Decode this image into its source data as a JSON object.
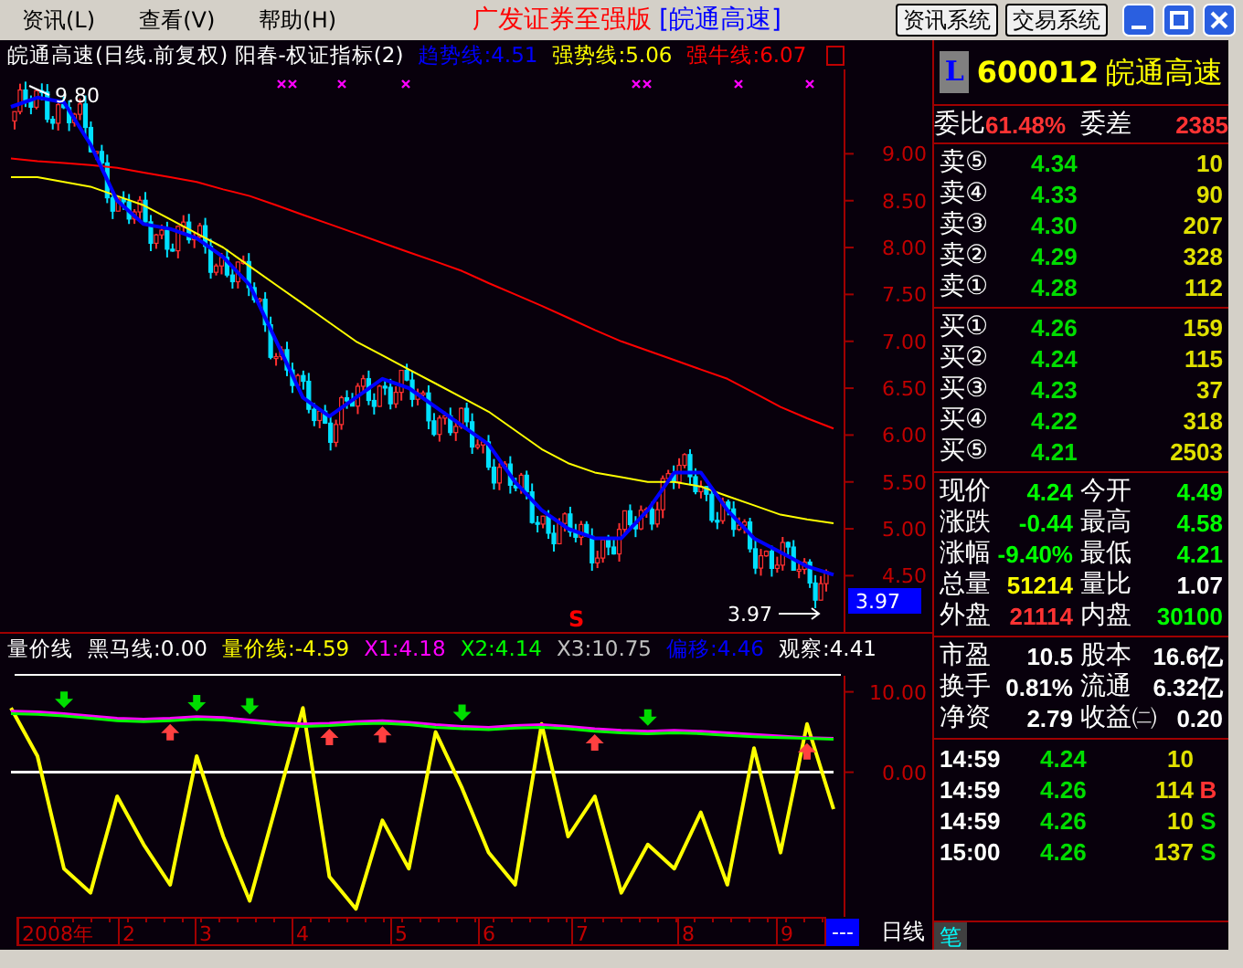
{
  "menu": [
    {
      "label": "资讯(L)"
    },
    {
      "label": "查看(V)"
    },
    {
      "label": "帮助(H)"
    }
  ],
  "title": {
    "app": "广发证券至强版",
    "stock": "[皖通高速]"
  },
  "system_buttons": [
    "资讯系统",
    "交易系统"
  ],
  "chart": {
    "title": "皖通高速(日线.前复权) 阳春-权证指标(2)",
    "lines": [
      {
        "label": "趋势线:4.51",
        "color": "#0000ff"
      },
      {
        "label": "强势线:5.06",
        "color": "#ffff00"
      },
      {
        "label": "强牛线:6.07",
        "color": "#ff0000"
      }
    ],
    "high_label": "9.80",
    "low_label": "3.97",
    "last_price": "3.97",
    "signal": "S",
    "chart_data": {
      "type": "line",
      "ylim": [
        3.9,
        9.9
      ],
      "yticks": [
        {
          "value": 9,
          "label": "9.00"
        },
        {
          "value": 8.5,
          "label": "8.50"
        },
        {
          "value": 8,
          "label": "8.00"
        },
        {
          "value": 7.5,
          "label": "7.50"
        },
        {
          "value": 7,
          "label": "7.00"
        },
        {
          "value": 6.5,
          "label": "6.50"
        },
        {
          "value": 6,
          "label": "6.00"
        },
        {
          "value": 5.5,
          "label": "5.50"
        },
        {
          "value": 5,
          "label": "5.00"
        },
        {
          "value": 4.5,
          "label": "4.50"
        }
      ],
      "series": [
        {
          "color": "#0000ff",
          "values": [
            9.5,
            9.6,
            9.55,
            9.1,
            8.5,
            8.25,
            8.2,
            8.1,
            7.9,
            7.6,
            7.0,
            6.4,
            6.2,
            6.4,
            6.6,
            6.5,
            6.3,
            6.1,
            5.9,
            5.5,
            5.2,
            5.0,
            4.9,
            4.9,
            5.2,
            5.6,
            5.6,
            5.2,
            4.9,
            4.75,
            4.6,
            4.51
          ]
        },
        {
          "color": "#ffff00",
          "values": [
            8.75,
            8.75,
            8.7,
            8.65,
            8.55,
            8.45,
            8.3,
            8.15,
            8.0,
            7.8,
            7.6,
            7.4,
            7.2,
            7.0,
            6.85,
            6.7,
            6.55,
            6.4,
            6.25,
            6.05,
            5.85,
            5.7,
            5.6,
            5.55,
            5.5,
            5.5,
            5.45,
            5.35,
            5.25,
            5.15,
            5.1,
            5.06
          ]
        },
        {
          "color": "#ff0000",
          "values": [
            8.95,
            8.92,
            8.9,
            8.88,
            8.85,
            8.8,
            8.75,
            8.7,
            8.62,
            8.55,
            8.45,
            8.35,
            8.25,
            8.15,
            8.05,
            7.95,
            7.85,
            7.75,
            7.62,
            7.5,
            7.38,
            7.25,
            7.12,
            7.0,
            6.9,
            6.8,
            6.7,
            6.6,
            6.45,
            6.3,
            6.18,
            6.07
          ]
        }
      ]
    }
  },
  "indicator": {
    "name": "量价线",
    "values": [
      {
        "label": "黑马线:0.00",
        "color": "#ffffff"
      },
      {
        "label": "量价线:-4.59",
        "color": "#ffff00"
      },
      {
        "label": "X1:4.18",
        "color": "#ff00ff"
      },
      {
        "label": "X2:4.14",
        "color": "#00ff00"
      },
      {
        "label": "X3:10.75",
        "color": "#c0c0c0"
      },
      {
        "label": "偏移:4.46",
        "color": "#0000ff"
      },
      {
        "label": "观察:4.41",
        "color": "#ffffff"
      }
    ],
    "chart_data": {
      "type": "line",
      "ylim": [
        -18,
        12
      ],
      "yticks": [
        {
          "value": 10,
          "label": "10.00"
        },
        {
          "value": 0,
          "label": "0.00"
        }
      ],
      "series": [
        {
          "color": "#ffffff",
          "values": [
            0,
            0,
            0,
            0,
            0,
            0,
            0,
            0,
            0,
            0,
            0,
            0,
            0,
            0,
            0,
            0,
            0,
            0,
            0,
            0,
            0,
            0,
            0,
            0,
            0,
            0,
            0,
            0,
            0,
            0,
            0,
            0
          ]
        },
        {
          "color": "#ffff00",
          "values": [
            8,
            2,
            -12,
            -15,
            -3,
            -9,
            -14,
            2,
            -8,
            -16,
            -4,
            8,
            -13,
            -17,
            -6,
            -12,
            5,
            -2,
            -10,
            -14,
            6,
            -8,
            -3,
            -15,
            -9,
            -12,
            -5,
            -14,
            3,
            -10,
            6,
            -4.6
          ]
        },
        {
          "color": "#ff00ff",
          "values": [
            7.6,
            7.5,
            7.3,
            7.0,
            6.7,
            6.6,
            6.7,
            6.9,
            6.8,
            6.5,
            6.2,
            6.0,
            6.1,
            6.3,
            6.4,
            6.2,
            5.9,
            5.7,
            5.6,
            5.8,
            5.9,
            5.7,
            5.4,
            5.2,
            5.1,
            5.2,
            5.1,
            4.9,
            4.7,
            4.5,
            4.3,
            4.2
          ]
        },
        {
          "color": "#00ff00",
          "values": [
            7.3,
            7.2,
            7.0,
            6.7,
            6.4,
            6.3,
            6.4,
            6.6,
            6.5,
            6.2,
            5.9,
            5.7,
            5.8,
            6.0,
            6.1,
            5.9,
            5.6,
            5.4,
            5.3,
            5.5,
            5.6,
            5.4,
            5.1,
            4.9,
            4.8,
            4.9,
            4.8,
            4.6,
            4.4,
            4.3,
            4.2,
            4.1
          ]
        }
      ]
    }
  },
  "time_axis": {
    "year": "2008年",
    "months": [
      "2",
      "3",
      "4",
      "5",
      "6",
      "7",
      "8",
      "9"
    ],
    "period_button": "---",
    "period": "日线"
  },
  "quote": {
    "market_badge": "L",
    "code": "600012",
    "name": "皖通高速",
    "order_ratio": {
      "label": "委比",
      "value": "61.48%"
    },
    "order_diff": {
      "label": "委差",
      "value": "2385"
    },
    "asks": [
      {
        "label": "卖⑤",
        "price": "4.34",
        "volume": "10"
      },
      {
        "label": "卖④",
        "price": "4.33",
        "volume": "90"
      },
      {
        "label": "卖③",
        "price": "4.30",
        "volume": "207"
      },
      {
        "label": "卖②",
        "price": "4.29",
        "volume": "328"
      },
      {
        "label": "卖①",
        "price": "4.28",
        "volume": "112"
      }
    ],
    "bids": [
      {
        "label": "买①",
        "price": "4.26",
        "volume": "159"
      },
      {
        "label": "买②",
        "price": "4.24",
        "volume": "115"
      },
      {
        "label": "买③",
        "price": "4.23",
        "volume": "37"
      },
      {
        "label": "买④",
        "price": "4.22",
        "volume": "318"
      },
      {
        "label": "买⑤",
        "price": "4.21",
        "volume": "2503"
      }
    ],
    "stats": [
      {
        "label": "现价",
        "value": "4.24",
        "color": "#00ff00"
      },
      {
        "label": "今开",
        "value": "4.49",
        "color": "#00ff00"
      },
      {
        "label": "涨跌",
        "value": "-0.44",
        "color": "#00ff00"
      },
      {
        "label": "最高",
        "value": "4.58",
        "color": "#00ff00"
      },
      {
        "label": "涨幅",
        "value": "-9.40%",
        "color": "#00ff00"
      },
      {
        "label": "最低",
        "value": "4.21",
        "color": "#00ff00"
      },
      {
        "label": "总量",
        "value": "51214",
        "color": "#ffff00"
      },
      {
        "label": "量比",
        "value": "1.07",
        "color": "#ffffff"
      },
      {
        "label": "外盘",
        "value": "21114",
        "color": "#ff3333"
      },
      {
        "label": "内盘",
        "value": "30100",
        "color": "#00ff00"
      }
    ],
    "fundamentals": [
      {
        "label": "市盈",
        "value": "10.5"
      },
      {
        "label": "股本",
        "value": "16.6亿"
      },
      {
        "label": "换手",
        "value": "0.81%"
      },
      {
        "label": "流通",
        "value": "6.32亿"
      },
      {
        "label": "净资",
        "value": "2.79"
      },
      {
        "label": "收益㈡",
        "value": "0.20"
      }
    ],
    "trades": [
      {
        "time": "14:59",
        "price": "4.24",
        "volume": "10"
      },
      {
        "time": "14:59",
        "price": "4.26",
        "volume": "114",
        "side": "B"
      },
      {
        "time": "14:59",
        "price": "4.26",
        "volume": "10",
        "side": "S"
      },
      {
        "time": "15:00",
        "price": "4.26",
        "volume": "137",
        "side": "S"
      }
    ],
    "tabs": [
      {
        "label": "笔",
        "selected": true
      }
    ]
  }
}
